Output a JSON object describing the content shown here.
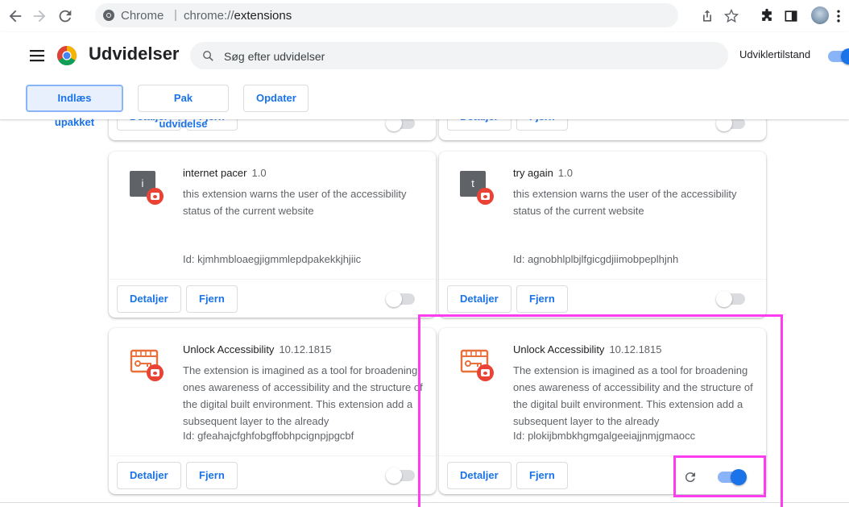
{
  "browser": {
    "omnibox_prefix": "Chrome",
    "omnibox_separator": "|",
    "omnibox_scheme": "chrome://",
    "omnibox_host": "extensions"
  },
  "header": {
    "title": "Udvidelser",
    "search_placeholder": "Søg efter udvidelser",
    "developer_mode_label": "Udviklertilstand",
    "developer_mode_on": true
  },
  "actions": {
    "load_unpacked": "Indlæs upakket",
    "pack_extension": "Pak udvidelse",
    "update": "Opdater"
  },
  "card_buttons": {
    "details": "Detaljer",
    "remove": "Fjern"
  },
  "extensions": [
    {
      "name": "internet pacer",
      "version": "1.0",
      "icon_letter": "i",
      "description": "this extension warns the user of the accessibility status of the current website",
      "id": "Id: kjmhmbloaegjigmmlepdpakekkjhjiic",
      "enabled": false
    },
    {
      "name": "try again",
      "version": "1.0",
      "icon_letter": "t",
      "description": "this extension warns the user of the accessibility status of the current website",
      "id": "Id: agnobhlplbjlfgicgdjiimobpeplhjnh",
      "enabled": false
    },
    {
      "name": "Unlock Accessibility",
      "version": "10.12.1815",
      "description": "The extension is imagined as a tool for broadening ones awareness of accessibility and the structure of the digital built environment. This extension add a subsequent layer to the already",
      "id": "Id: gfeahajcfghfobgffobhpcignpjpgcbf",
      "enabled": false
    },
    {
      "name": "Unlock Accessibility",
      "version": "10.12.1815",
      "description": "The extension is imagined as a tool for broadening ones awareness of accessibility and the structure of the digital built environment. This extension add a subsequent layer to the already",
      "id": "Id: plokijbmbkhgmgalgeeiajjnmjgmaocc",
      "enabled": true
    }
  ],
  "colors": {
    "accent": "#1a73e8",
    "highlight": "#ff3df0",
    "badge": "#ea4335"
  }
}
